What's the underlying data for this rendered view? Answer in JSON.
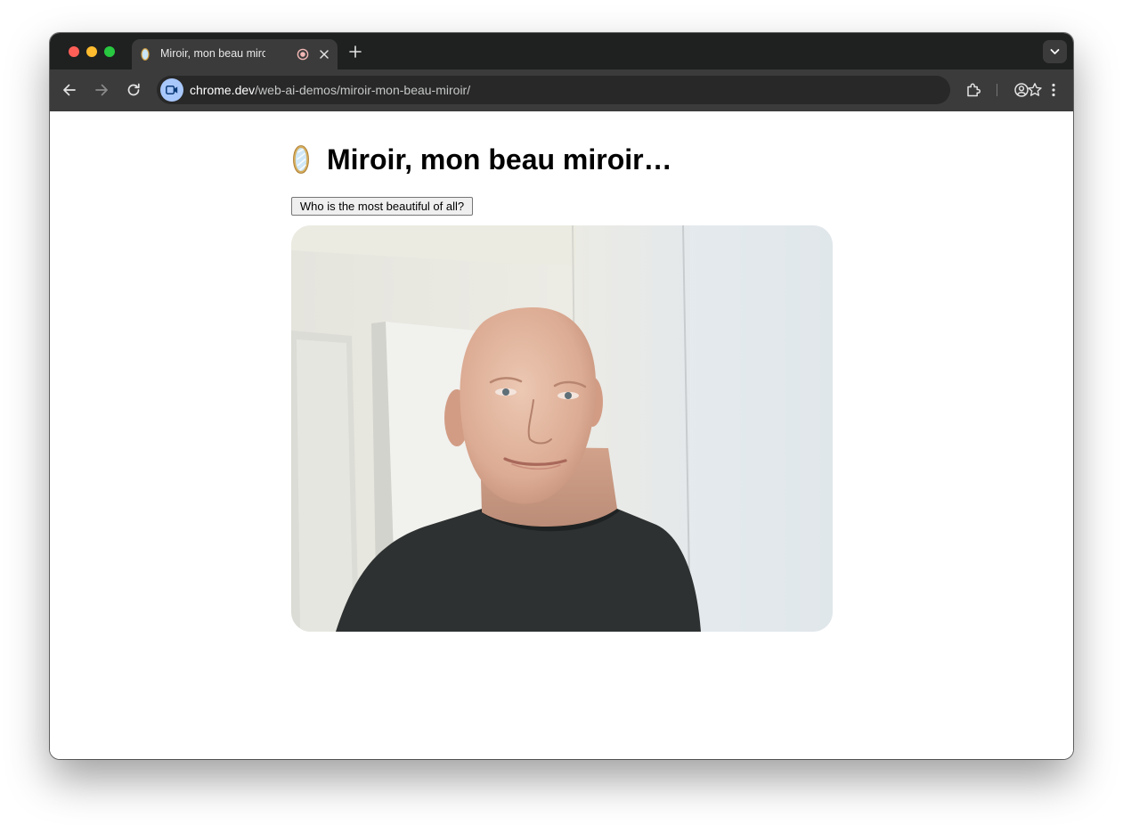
{
  "browser": {
    "tab": {
      "title": "Miroir, mon beau miroir...",
      "favicon": "mirror-icon",
      "indicator": "recording-icon"
    },
    "toolbar": {
      "url_host": "chrome.dev",
      "url_path": "/web-ai-demos/miroir-mon-beau-miroir/",
      "site_chip_icon": "video-camera-icon"
    }
  },
  "page": {
    "heading": "Miroir, mon beau miroir…",
    "heading_icon": "mirror-icon",
    "button_label": "Who is the most beautiful of all?",
    "video": {
      "subject": "webcam-feed"
    }
  }
}
